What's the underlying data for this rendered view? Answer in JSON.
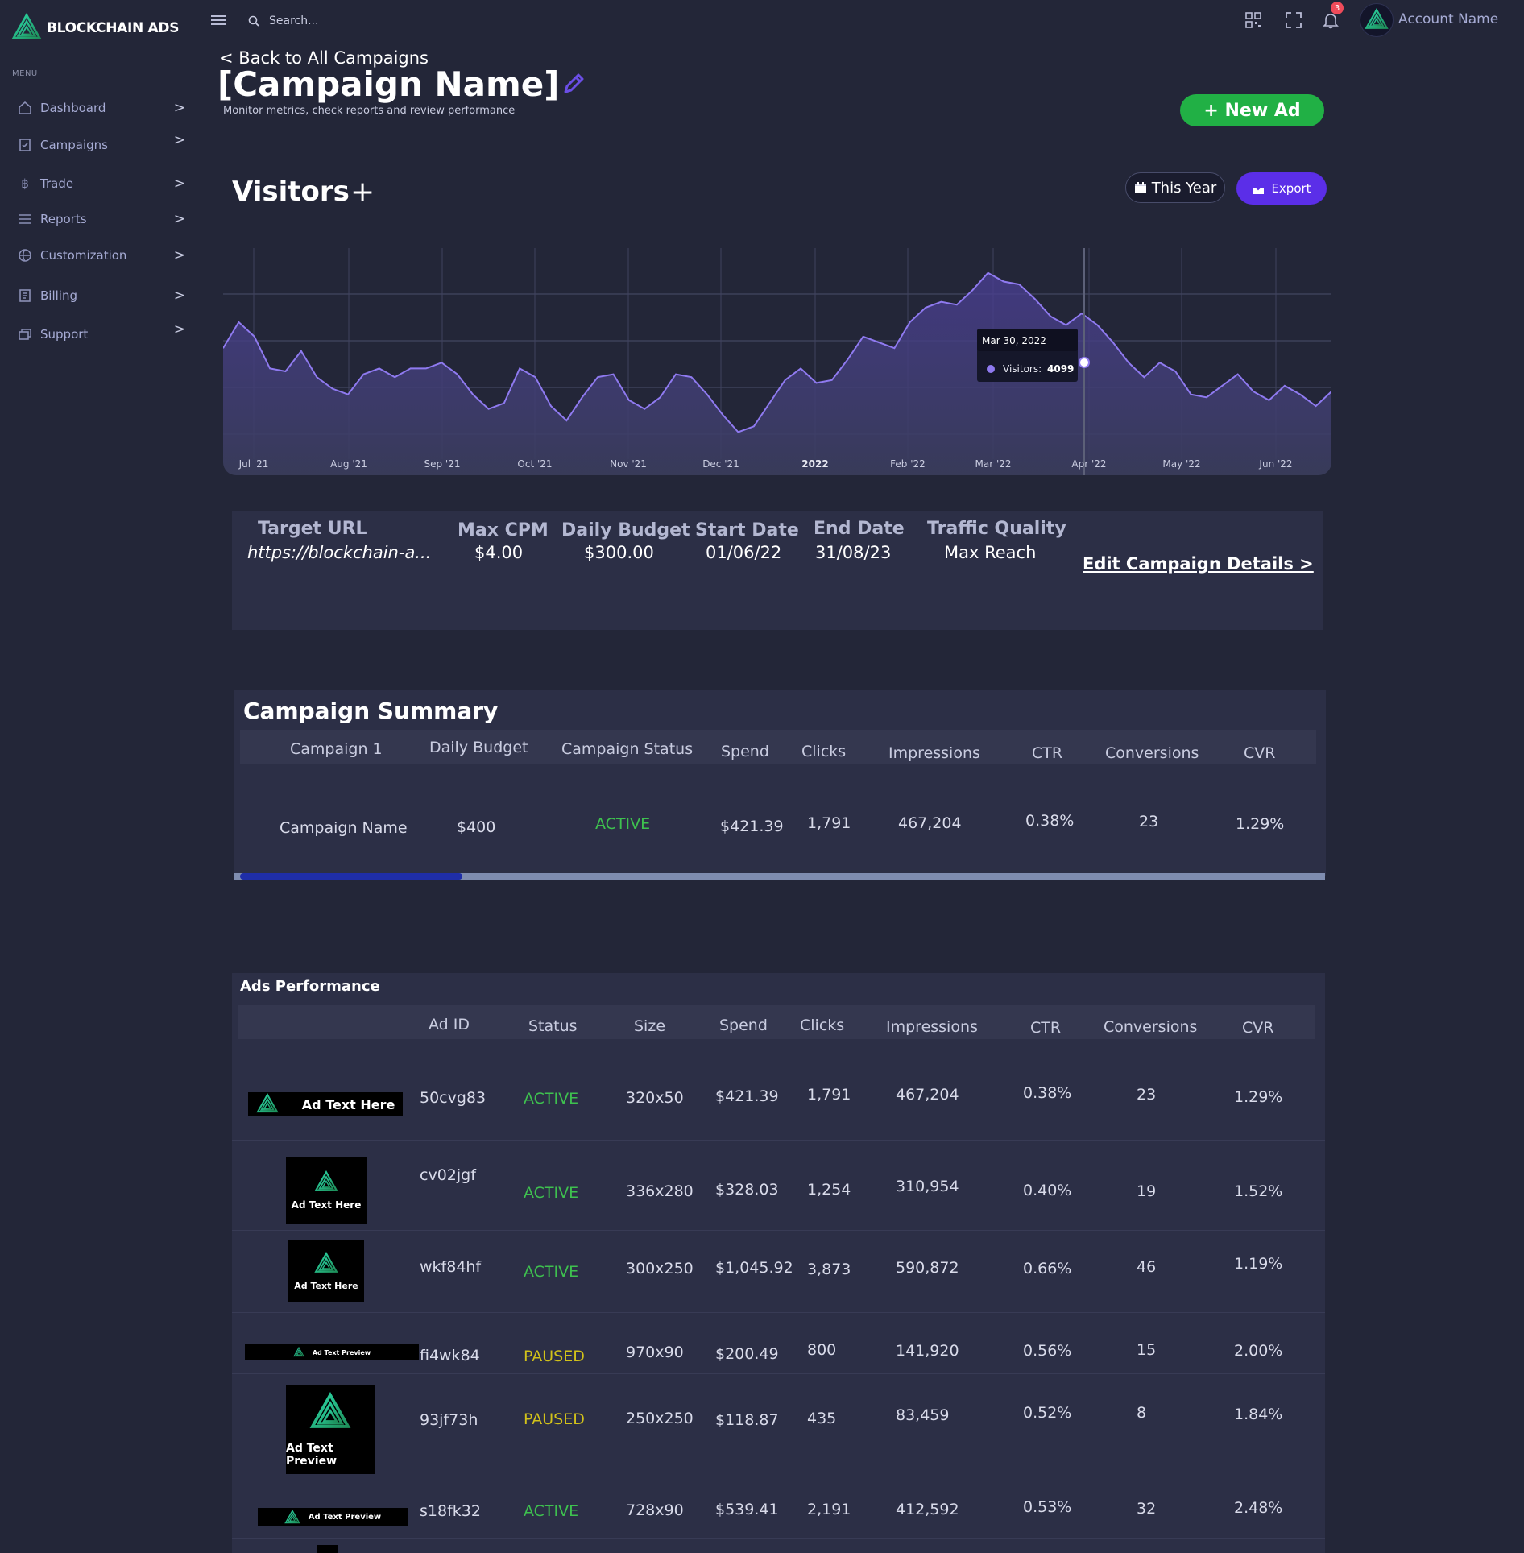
{
  "app": {
    "brand": "BLOCKCHAIN ADS"
  },
  "sidebar": {
    "menu_caption": "MENU",
    "items": [
      {
        "label": "Dashboard",
        "icon": "home-icon"
      },
      {
        "label": "Campaigns",
        "icon": "clipboard-icon"
      },
      {
        "label": "Trade",
        "icon": "bitcoin-icon"
      },
      {
        "label": "Reports",
        "icon": "list-icon"
      },
      {
        "label": "Customization",
        "icon": "globe-icon"
      },
      {
        "label": "Billing",
        "icon": "billing-icon"
      },
      {
        "label": "Support",
        "icon": "support-icon"
      }
    ],
    "chevron": ">"
  },
  "topbar": {
    "search_placeholder": "Search...",
    "notification_count": "3",
    "account_name": "Account Name"
  },
  "header": {
    "back_link": "< Back to All Campaigns",
    "title": "[Campaign Name]",
    "subtitle": "Monitor metrics, check reports and review performance",
    "new_ad_label": "+ New Ad"
  },
  "visitors": {
    "title": "Visitors",
    "add_label": "+",
    "period_label": "This Year",
    "export_label": "Export"
  },
  "chart_data": {
    "type": "area",
    "series": [
      {
        "name": "Visitors",
        "values": [
          3500,
          3950,
          3700,
          3150,
          3100,
          3450,
          3000,
          2800,
          2700,
          3050,
          3150,
          3000,
          3150,
          3150,
          3250,
          3050,
          2700,
          2450,
          2550,
          3150,
          3000,
          2500,
          2250,
          2650,
          3000,
          3050,
          2600,
          2450,
          2650,
          3050,
          3000,
          2700,
          2350,
          2050,
          2150,
          2550,
          2950,
          3150,
          2900,
          2950,
          3300,
          3700,
          3600,
          3500,
          3950,
          4200,
          4300,
          4250,
          4500,
          4800,
          4650,
          4600,
          4350,
          4050,
          3900,
          4100,
          3900,
          3600,
          3250,
          3000,
          3250,
          3100,
          2700,
          2650,
          2850,
          3050,
          2750,
          2600,
          2850,
          2700,
          2500,
          2750
        ]
      }
    ],
    "x_tick_labels": [
      "Jul '21",
      "Aug '21",
      "Sep '21",
      "Oct '21",
      "Nov '21",
      "Dec '21",
      "2022",
      "Feb '22",
      "Mar '22",
      "Apr '22",
      "May '22",
      "Jun '22"
    ],
    "ylim": [
      1500,
      5200
    ],
    "grid": true,
    "tooltip": {
      "date": "Mar 30, 2022",
      "series": "Visitors:",
      "value": "4099"
    }
  },
  "details": {
    "target_url_label": "Target URL",
    "target_url_value": "https://blockchain-a...",
    "max_cpm_label": "Max CPM",
    "max_cpm_value": "$4.00",
    "daily_budget_label": "Daily Budget",
    "daily_budget_value": "$300.00",
    "start_date_label": "Start Date",
    "start_date_value": "01/06/22",
    "end_date_label": "End Date",
    "end_date_value": "31/08/23",
    "traffic_quality_label": "Traffic Quality",
    "traffic_quality_value": "Max Reach",
    "edit_link": "Edit Campaign Details >"
  },
  "summary": {
    "title": "Campaign Summary",
    "columns": [
      "Campaign 1",
      "Daily Budget",
      "Campaign Status",
      "Spend",
      "Clicks",
      "Impressions",
      "CTR",
      "Conversions",
      "CVR"
    ],
    "row": [
      "Campaign Name",
      "$400",
      "ACTIVE",
      "$421.39",
      "1,791",
      "467,204",
      "0.38%",
      "23",
      "1.29%"
    ]
  },
  "ads": {
    "title": "Ads Performance",
    "columns": [
      "Ad ID",
      "Status",
      "Size",
      "Spend",
      "Clicks",
      "Impressions",
      "CTR",
      "Conversions",
      "CVR"
    ],
    "rows": [
      {
        "thumb_text": "Ad Text Here",
        "id": "50cvg83",
        "status": "ACTIVE",
        "size": "320x50",
        "spend": "$421.39",
        "clicks": "1,791",
        "impressions": "467,204",
        "ctr": "0.38%",
        "conversions": "23",
        "cvr": "1.29%"
      },
      {
        "thumb_text": "Ad Text Here",
        "id": "cv02jgf",
        "status": "ACTIVE",
        "size": "336x280",
        "spend": "$328.03",
        "clicks": "1,254",
        "impressions": "310,954",
        "ctr": "0.40%",
        "conversions": "19",
        "cvr": "1.52%"
      },
      {
        "thumb_text": "Ad Text Here",
        "id": "wkf84hf",
        "status": "ACTIVE",
        "size": "300x250",
        "spend": "$1,045.92",
        "clicks": "3,873",
        "impressions": "590,872",
        "ctr": "0.66%",
        "conversions": "46",
        "cvr": "1.19%"
      },
      {
        "thumb_text": "Ad Text Preview",
        "id": "fi4wk84",
        "status": "PAUSED",
        "size": "970x90",
        "spend": "$200.49",
        "clicks": "800",
        "impressions": "141,920",
        "ctr": "0.56%",
        "conversions": "15",
        "cvr": "2.00%"
      },
      {
        "thumb_text": "Ad Text Preview",
        "id": "93jf73h",
        "status": "PAUSED",
        "size": "250x250",
        "spend": "$118.87",
        "clicks": "435",
        "impressions": "83,459",
        "ctr": "0.52%",
        "conversions": "8",
        "cvr": "1.84%"
      },
      {
        "thumb_text": "Ad Text Preview",
        "id": "s18fk32",
        "status": "ACTIVE",
        "size": "728x90",
        "spend": "$539.41",
        "clicks": "2,191",
        "impressions": "412,592",
        "ctr": "0.53%",
        "conversions": "32",
        "cvr": "2.48%"
      }
    ]
  },
  "colors": {
    "background": "#232638",
    "panel": "#2c2f46",
    "accent_green": "#21b045",
    "accent_purple": "#5b2ee8",
    "chart_line": "#8f7af0",
    "status_active": "#3ec14f",
    "status_paused": "#d2c21a"
  }
}
